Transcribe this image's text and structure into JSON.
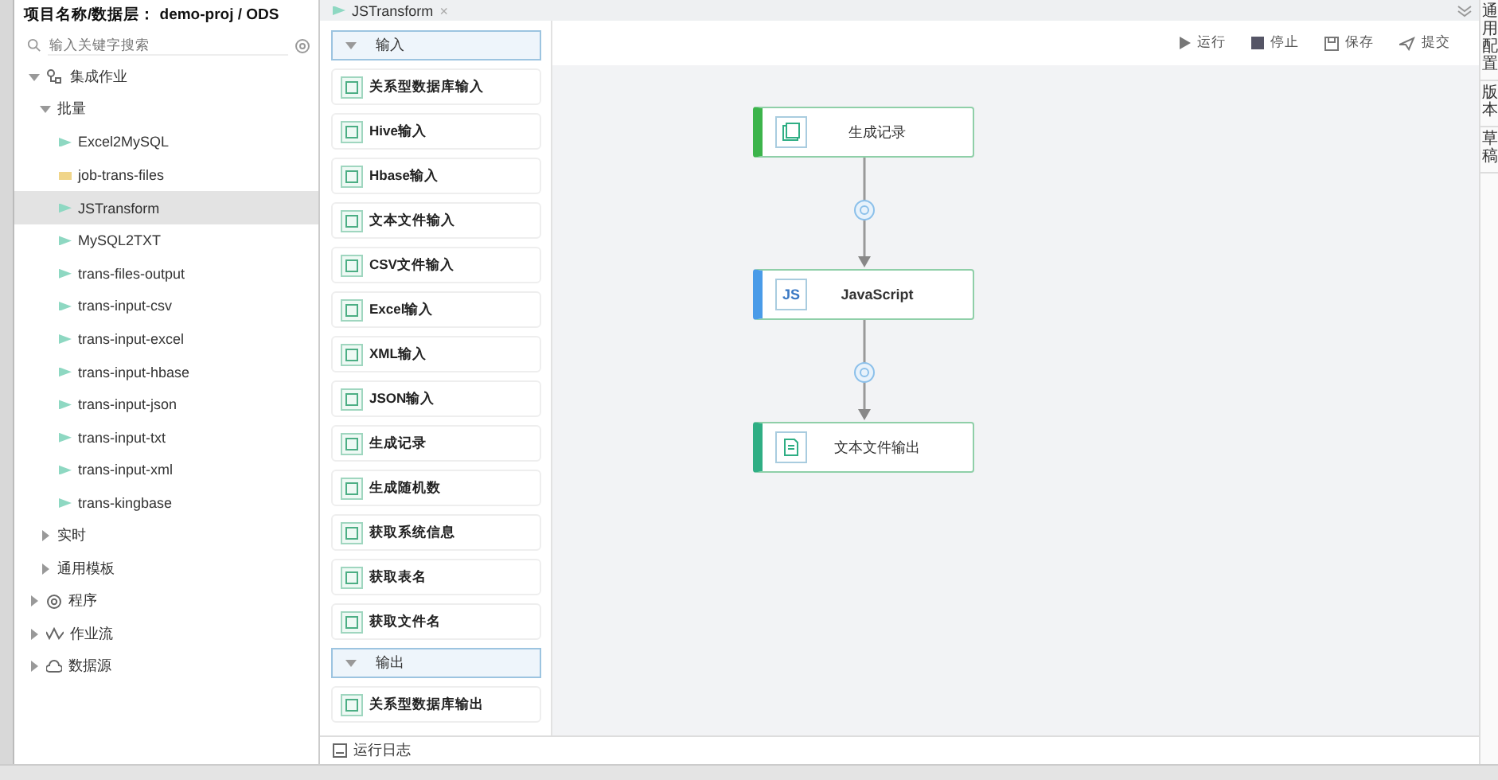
{
  "project": {
    "label": "项目名称/数据层：",
    "value": "demo-proj / ODS"
  },
  "search": {
    "placeholder": "输入关键字搜索"
  },
  "tree": [
    {
      "label": "集成作业",
      "expanded": true,
      "children": [
        {
          "label": "批量",
          "expanded": true,
          "children": [
            {
              "label": "Excel2MySQL",
              "kind": "transform",
              "selected": false
            },
            {
              "label": "job-trans-files",
              "kind": "job",
              "selected": false
            },
            {
              "label": "JSTransform",
              "kind": "transform",
              "selected": true
            },
            {
              "label": "MySQL2TXT",
              "kind": "transform",
              "selected": false
            },
            {
              "label": "trans-files-output",
              "kind": "transform",
              "selected": false
            },
            {
              "label": "trans-input-csv",
              "kind": "transform",
              "selected": false
            },
            {
              "label": "trans-input-excel",
              "kind": "transform",
              "selected": false
            },
            {
              "label": "trans-input-hbase",
              "kind": "transform",
              "selected": false
            },
            {
              "label": "trans-input-json",
              "kind": "transform",
              "selected": false
            },
            {
              "label": "trans-input-txt",
              "kind": "transform",
              "selected": false
            },
            {
              "label": "trans-input-xml",
              "kind": "transform",
              "selected": false
            },
            {
              "label": "trans-kingbase",
              "kind": "transform",
              "selected": false
            }
          ]
        },
        {
          "label": "实时",
          "expanded": false
        },
        {
          "label": "通用模板",
          "expanded": false
        }
      ]
    },
    {
      "label": "程序",
      "expanded": false
    },
    {
      "label": "作业流",
      "expanded": false
    },
    {
      "label": "数据源",
      "expanded": false
    }
  ],
  "tab": {
    "label": "JSTransform",
    "close": "×"
  },
  "palette": [
    {
      "title": "输入",
      "expanded": true,
      "items": [
        "关系型数据库输入",
        "Hive输入",
        "Hbase输入",
        "文本文件输入",
        "CSV文件输入",
        "Excel输入",
        "XML输入",
        "JSON输入",
        "生成记录",
        "生成随机数",
        "获取系统信息",
        "获取表名",
        "获取文件名"
      ]
    },
    {
      "title": "输出",
      "expanded": true,
      "items": [
        "关系型数据库输出"
      ]
    }
  ],
  "toolbar": [
    "运行",
    "停止",
    "保存",
    "提交"
  ],
  "nodes": [
    {
      "label": "生成记录",
      "color": "#3cb44b"
    },
    {
      "label": "JavaScript",
      "badge": "JS",
      "color": "#4a9be8"
    },
    {
      "label": "文本文件输出",
      "color": "#2fae84"
    }
  ],
  "right_panel": [
    "通用配置",
    "版本",
    "草稿"
  ],
  "log": {
    "label": "运行日志"
  }
}
